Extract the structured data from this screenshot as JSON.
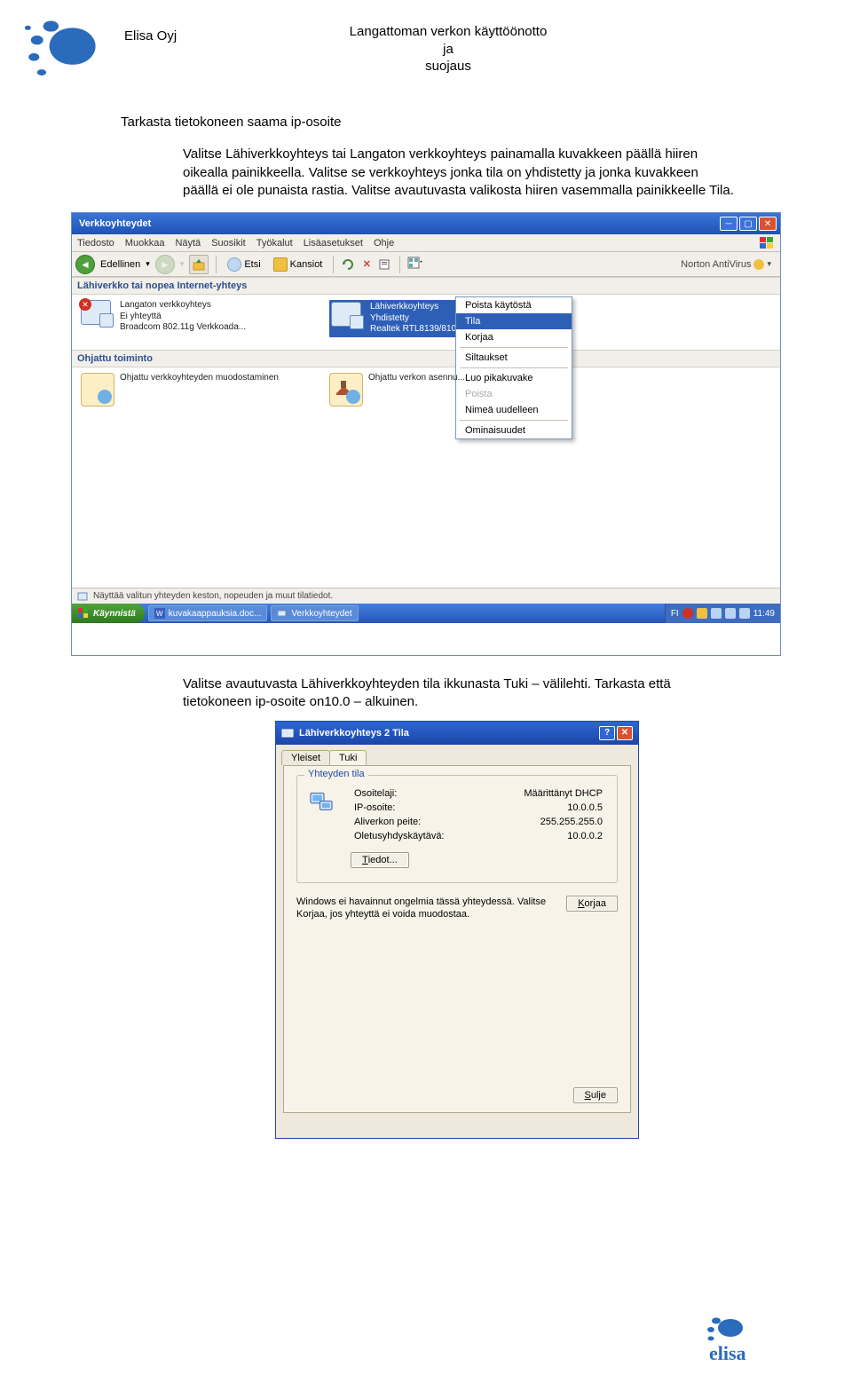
{
  "header": {
    "company": "Elisa Oyj",
    "title_line1": "Langattoman verkon käyttöönotto",
    "title_line2": "ja",
    "title_line3": "suojaus"
  },
  "body": {
    "heading": "Tarkasta tietokoneen saama ip-osoite",
    "para1": "Valitse Lähiverkkoyhteys tai Langaton verkkoyhteys painamalla kuvakkeen päällä hiiren oikealla painikkeella. Valitse se verkkoyhteys jonka tila on yhdistetty ja jonka kuvakkeen päällä ei ole punaista rastia. Valitse avautuvasta valikosta hiiren vasemmalla painikkeelle Tila.",
    "para2": "Valitse avautuvasta Lähiverkkoyhteyden tila ikkunasta Tuki – välilehti. Tarkasta että tietokoneen ip-osoite on10.0 – alkuinen."
  },
  "win1": {
    "title": "Verkkoyhteydet",
    "menus": [
      "Tiedosto",
      "Muokkaa",
      "Näytä",
      "Suosikit",
      "Työkalut",
      "Lisäasetukset",
      "Ohje"
    ],
    "toolbar": {
      "back": "Edellinen",
      "search": "Etsi",
      "folders": "Kansiot",
      "norton": "Norton AntiVirus"
    },
    "groups": {
      "lan": "Lähiverkko tai nopea Internet-yhteys",
      "wizard": "Ohjattu toiminto"
    },
    "conn_left": {
      "name": "Langaton verkkoyhteys",
      "status": "Ei yhteyttä",
      "device": "Broadcom 802.11g Verkkoada..."
    },
    "conn_right": {
      "name": "Lähiverkkoyhteys",
      "status": "Yhdistetty",
      "device": "Realtek RTL8139/810x"
    },
    "wiz_left": "Ohjattu verkkoyhteyden muodostaminen",
    "wiz_right": "Ohjattu verkon asennu...",
    "ctx": {
      "i1": "Poista käytöstä",
      "i2": "Tila",
      "i3": "Korjaa",
      "i4": "Siltaukset",
      "i5": "Luo pikakuvake",
      "i6": "Poista",
      "i7": "Nimeä uudelleen",
      "i8": "Ominaisuudet"
    },
    "status_text": "Näyttää valitun yhteyden keston, nopeuden ja muut tilatiedot.",
    "start": "Käynnistä",
    "task1": "kuvakaappauksia.doc...",
    "task2": "Verkkoyhteydet",
    "clock": "11:49",
    "tray_lang": "FI"
  },
  "dlg": {
    "title": "Lähiverkkoyhteys 2 Tila",
    "tab1": "Yleiset",
    "tab2": "Tuki",
    "legend": "Yhteyden tila",
    "row1_lab": "Osoitelaji:",
    "row1_val": "Määrittänyt DHCP",
    "row2_lab": "IP-osoite:",
    "row2_val": "10.0.0.5",
    "row3_lab": "Aliverkon peite:",
    "row3_val": "255.255.255.0",
    "row4_lab": "Oletusyhdyskäytävä:",
    "row4_val": "10.0.0.2",
    "details_btn": "Tiedot...",
    "help_text": "Windows ei havainnut ongelmia tässä yhteydessä. Valitse Korjaa, jos yhteyttä ei voida muodostaa.",
    "fix_btn": "Korjaa",
    "close_btn": "Sulje"
  }
}
